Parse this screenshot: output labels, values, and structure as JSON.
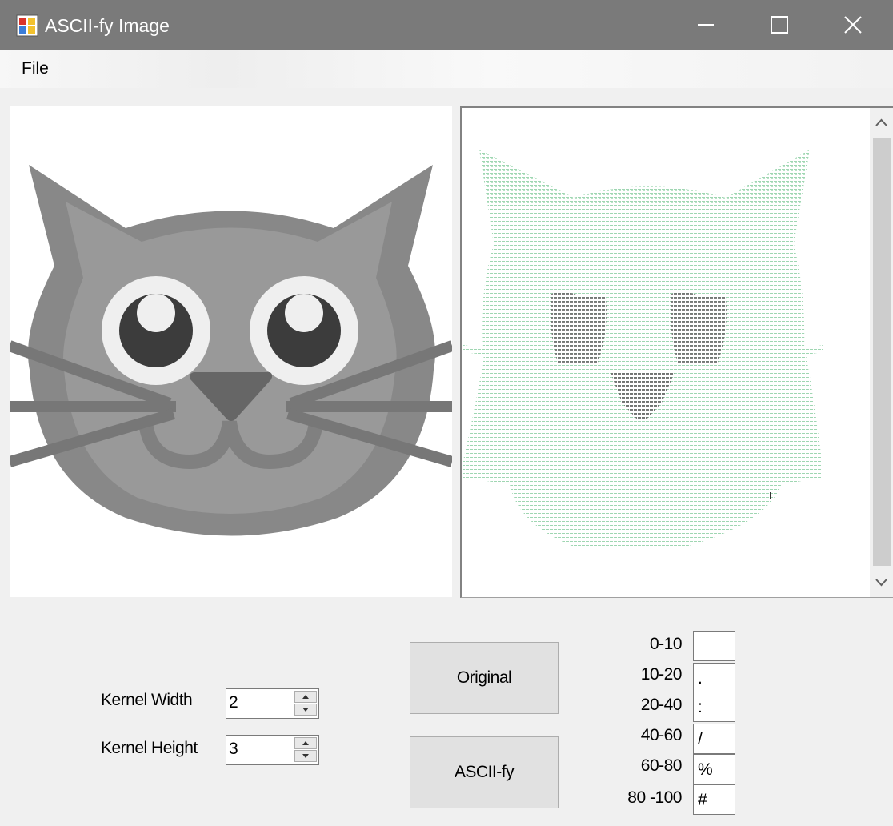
{
  "window": {
    "title": "ASCII-fy Image"
  },
  "menu": {
    "file_label": "File"
  },
  "controls": {
    "kernel_width_label": "Kernel Width",
    "kernel_width_value": "2",
    "kernel_height_label": "Kernel Height",
    "kernel_height_value": "3"
  },
  "buttons": {
    "original_label": "Original",
    "asciify_label": "ASCII-fy"
  },
  "mapping": [
    {
      "range": "0-10",
      "char": ""
    },
    {
      "range": "10-20",
      "char": "."
    },
    {
      "range": "20-40",
      "char": ":"
    },
    {
      "range": "40-60",
      "char": "/"
    },
    {
      "range": "60-80",
      "char": "%"
    },
    {
      "range": "80 -100",
      "char": "#"
    }
  ],
  "colors": {
    "titlebar": "#7a7a7a",
    "ascii_fill": "#93d0a8",
    "ascii_dark": "#666666"
  },
  "icons": {
    "app": "app-icon",
    "minimize": "minimize-icon",
    "maximize": "maximize-icon",
    "close": "close-icon",
    "scroll_up": "chevron-up-icon",
    "scroll_down": "chevron-down-icon"
  }
}
